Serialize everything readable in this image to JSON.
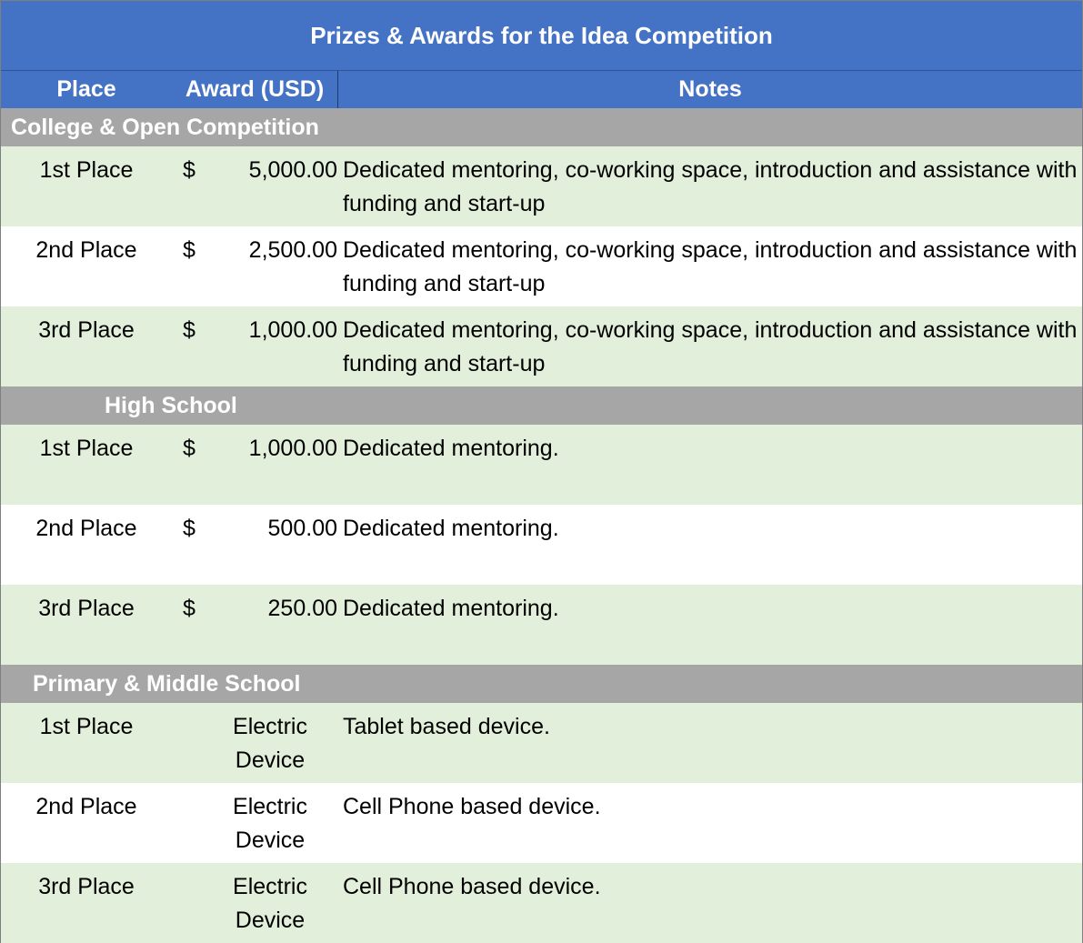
{
  "title": "Prizes & Awards for the Idea Competition",
  "headers": {
    "place": "Place",
    "award": "Award (USD)",
    "notes": "Notes"
  },
  "sections": [
    {
      "name": "College & Open Competition",
      "rows": [
        {
          "place": "1st Place",
          "currency": "$",
          "amount": "5,000.00",
          "notes": "Dedicated mentoring, co-working space, introduction and assistance with funding and start-up"
        },
        {
          "place": "2nd Place",
          "currency": "$",
          "amount": "2,500.00",
          "notes": "Dedicated mentoring, co-working space, introduction and assistance with funding and start-up"
        },
        {
          "place": "3rd Place",
          "currency": "$",
          "amount": "1,000.00",
          "notes": "Dedicated mentoring, co-working space, introduction and assistance with funding and start-up"
        }
      ]
    },
    {
      "name": "High School",
      "rows": [
        {
          "place": "1st Place",
          "currency": "$",
          "amount": "1,000.00",
          "notes": "Dedicated mentoring."
        },
        {
          "place": "2nd Place",
          "currency": "$",
          "amount": "500.00",
          "notes": "Dedicated mentoring."
        },
        {
          "place": "3rd Place",
          "currency": "$",
          "amount": "250.00",
          "notes": "Dedicated mentoring."
        }
      ]
    },
    {
      "name": "Primary & Middle School",
      "rows": [
        {
          "place": "1st Place",
          "award": "Electric Device",
          "notes": "Tablet based device."
        },
        {
          "place": "2nd Place",
          "award": "Electric Device",
          "notes": "Cell Phone based device."
        },
        {
          "place": "3rd Place",
          "award": "Electric Device",
          "notes": "Cell Phone based device."
        }
      ]
    }
  ],
  "colors": {
    "header_blue": "#4472c4",
    "section_gray": "#a6a6a6",
    "row_green": "#e2efda"
  }
}
